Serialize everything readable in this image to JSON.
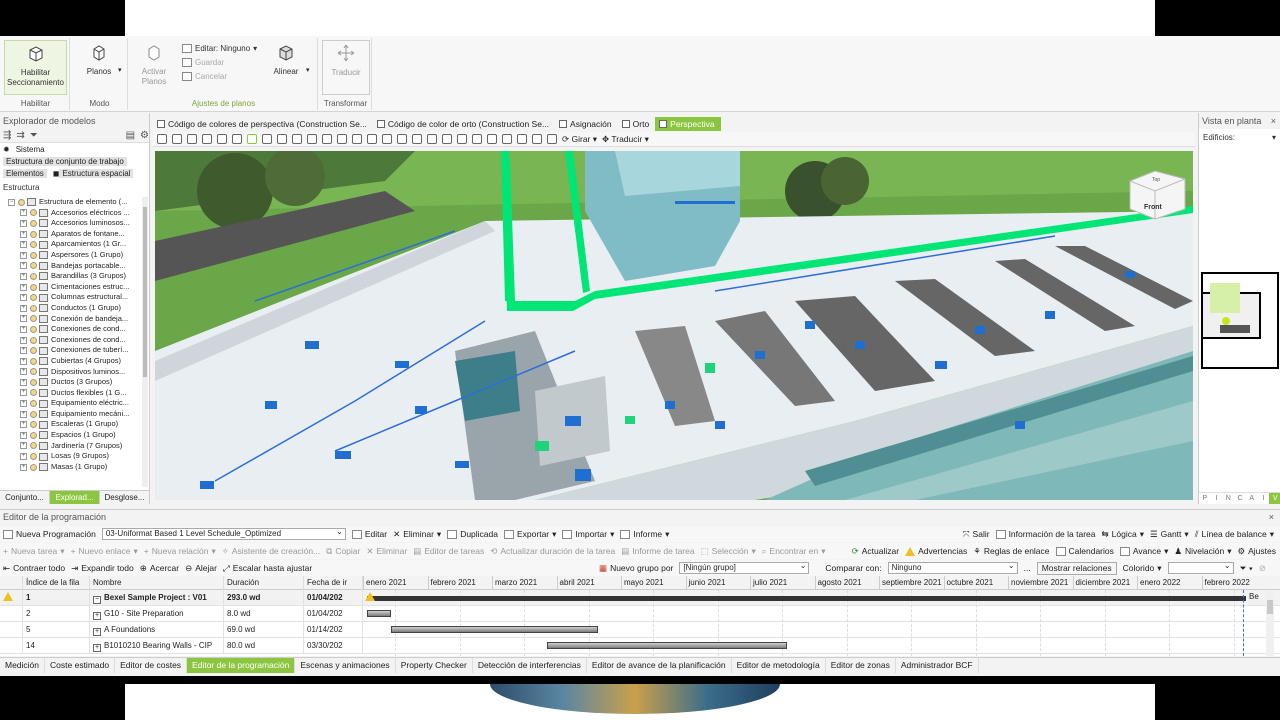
{
  "ribbon": {
    "habilitar": "Habilitar\nSeccionamiento",
    "habilitar_group": "Habilitar",
    "planos": "Planos",
    "modo_group": "Modo",
    "activar_planos": "Activar\nPlanos",
    "editar": "Editar: Ninguno",
    "guardar": "Guardar",
    "cancelar": "Cancelar",
    "alinear": "Alinear",
    "ajustes_group": "Ajustes de planos",
    "traducir": "Traducir",
    "transformar_group": "Transformar"
  },
  "left": {
    "title": "Explorador de modelos",
    "sistema": "Sistema",
    "estructura_conjunto": "Estructura de conjunto de trabajo",
    "elementos": "Elementos",
    "estructura_espacial": "Estructura espacial",
    "estructura": "Estructura",
    "tree": [
      "Estructura de elemento (...",
      "Accesorios eléctricos ...",
      "Accesorios luminosos...",
      "Aparatos de fontane...",
      "Aparcamientos (1 Gr...",
      "Aspersores (1 Grupo)",
      "Bandejas portacable...",
      "Barandillas (3 Grupos)",
      "Cimentaciones estruc...",
      "Columnas estructural...",
      "Conductos (1 Grupo)",
      "Conexión de bandeja...",
      "Conexiones de cond...",
      "Conexiones de cond...",
      "Conexiones de tuberí...",
      "Cubiertas (4 Grupos)",
      "Dispositivos luminos...",
      "Ductos (3 Grupos)",
      "Ductos flexibles (1 G...",
      "Equipamiento eléctric...",
      "Equipamiento mecáni...",
      "Escaleras (1 Grupo)",
      "Espacios (1 Grupo)",
      "Jardinería (7 Grupos)",
      "Losas (9 Grupos)",
      "Masas (1 Grupo)"
    ],
    "tabs": [
      "Conjunto...",
      "Explorad...",
      "Desglose..."
    ]
  },
  "viewtabs": [
    "Código de colores de perspectiva (Construction Se...",
    "Código de color de orto (Construction Se...",
    "Asignación",
    "Orto",
    "Perspectiva"
  ],
  "vtool": {
    "girar": "Girar",
    "traducir": "Traducir"
  },
  "viewcube": {
    "top": "Top",
    "front": "Front"
  },
  "right": {
    "title": "Vista en planta",
    "edificios": "Edificios:",
    "pincai": [
      "P",
      "I",
      "N",
      "C",
      "A",
      "I",
      "V"
    ]
  },
  "schedule": {
    "title": "Editor de la programación",
    "close": "×",
    "row1": {
      "nueva": "Nueva Programación",
      "combo": "03-Uniformat Based 1 Level Schedule_Optimized",
      "editar": "Editar",
      "eliminar": "Eliminar",
      "duplicada": "Duplicada",
      "exportar": "Exportar",
      "importar": "Importar",
      "informe": "Informe",
      "salir": "Salir",
      "info_tarea": "Información de la tarea",
      "logica": "Lógica",
      "gantt": "Gantt",
      "linea_balance": "Línea de balance"
    },
    "row2": {
      "nueva_tarea": "Nueva tarea",
      "nuevo_enlace": "Nuevo enlace",
      "nueva_relacion": "Nueva relación",
      "asistente": "Asistente de creación...",
      "copiar": "Copiar",
      "eliminar": "Eliminar",
      "editor_tareas": "Editor de tareas",
      "actualizar_duracion": "Actualizar duración de la tarea",
      "informe_tarea": "Informe de tarea",
      "seleccion": "Selección",
      "encontrar": "Encontrar en",
      "actualizar": "Actualizar",
      "advertencias": "Advertencias",
      "reglas": "Reglas de enlace",
      "calendarios": "Calendarios",
      "avance": "Avance",
      "nivelacion": "Nivelación",
      "ajustes": "Ajustes"
    },
    "row3": {
      "contraer": "Contraer todo",
      "expandir": "Expandir todo",
      "acercar": "Acercar",
      "alejar": "Alejar",
      "escalar": "Escalar hasta ajustar",
      "nuevo_grupo": "Nuevo grupo por",
      "grupo_val": "[Ningún grupo]",
      "comparar": "Comparar con:",
      "comparar_val": "Ninguno",
      "dots": "...",
      "mostrar": "Mostrar relaciones",
      "colorido": "Colorido"
    },
    "columns": [
      "Índice de la fila",
      "Nombre",
      "Duración",
      "Fecha de ir"
    ],
    "months": [
      "enero 2021",
      "febrero 2021",
      "marzo 2021",
      "abril 2021",
      "mayo 2021",
      "junio 2021",
      "julio 2021",
      "agosto 2021",
      "septiembre 2021",
      "octubre 2021",
      "noviembre 2021",
      "diciembre 2021",
      "enero 2022",
      "febrero 2022"
    ],
    "rows": [
      {
        "idx": "1",
        "name": "Bexel Sample Project : V01",
        "dur": "293.0 wd",
        "date": "01/04/202",
        "exp": "−"
      },
      {
        "idx": "2",
        "name": "G10 - Site Preparation",
        "dur": "8.0 wd",
        "date": "01/04/202",
        "exp": "+"
      },
      {
        "idx": "5",
        "name": "A Foundations",
        "dur": "69.0 wd",
        "date": "01/14/202",
        "exp": "+"
      },
      {
        "idx": "14",
        "name": "B1010210 Bearing Walls - CIP",
        "dur": "80.0 wd",
        "date": "03/30/202",
        "exp": "+"
      }
    ],
    "bar_end_label": "Be"
  },
  "bottom_tabs": [
    "Medición",
    "Coste estimado",
    "Editor de costes",
    "Editor de la programación",
    "Escenas y animaciones",
    "Property Checker",
    "Detección de interferencias",
    "Editor de avance de la planificación",
    "Editor de metodología",
    "Editor de zonas",
    "Administrador BCF"
  ],
  "colors": {
    "accent": "#8cc640",
    "grass": "#6ba94a",
    "highlight": "#00e676"
  }
}
